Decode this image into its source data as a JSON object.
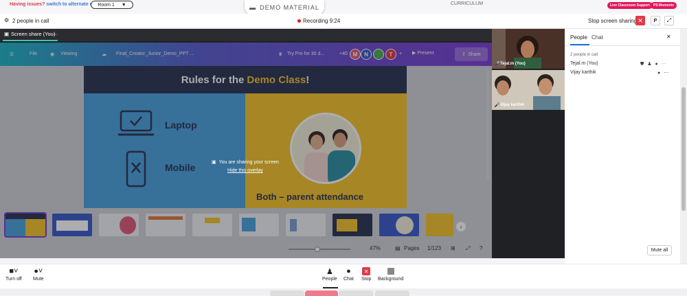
{
  "topbar": {
    "issue_text": "Having issues?",
    "switch_text": "switch to alternate room",
    "room": "Room 1",
    "demo_material": "DEMO MATERIAL",
    "curriculum": "CURRICULUM",
    "live_support": "Live Classroom Support",
    "ps_moments": "PS Moments"
  },
  "callbar": {
    "people_count": "2 people in call",
    "recording": "Recording 9:24",
    "stop_sharing": "Stop screen sharing",
    "p_label": "P"
  },
  "stage": {
    "tab_label": "Screen share (You)",
    "tab_more": "···"
  },
  "canva": {
    "file": "File",
    "viewing": "Viewing",
    "doc_name": "Final_Creator_Junior_Demo_PPT ...",
    "try_pro": "Try Pro for 30 d...",
    "plus_count": "+40",
    "avatars": [
      {
        "letter": "M",
        "color": "#e05a7a"
      },
      {
        "letter": "N",
        "color": "#3b5bc9"
      },
      {
        "letter": "",
        "color": "#4caf50"
      },
      {
        "letter": "T",
        "color": "#e03b4b"
      }
    ],
    "present": "Present",
    "share": "Share",
    "zoom": "47%",
    "pages": "Pages",
    "page_num": "1/123"
  },
  "slide": {
    "title_a": "Rules for the ",
    "title_b": "Demo Class",
    "title_c": "!",
    "laptop": "Laptop",
    "mobile": "Mobile",
    "both": "Both – parent attendance"
  },
  "overlay": {
    "message": "You are sharing your screen",
    "hide": "Hide this overlay"
  },
  "videos": [
    {
      "name": "Tejal.m (You)"
    },
    {
      "name": "Vijay karthik"
    }
  ],
  "panel": {
    "tabs": [
      "People",
      "Chat"
    ],
    "count": "2 people in call",
    "people": [
      {
        "name": "Tejal.m (You)"
      },
      {
        "name": "Vijay karthik"
      }
    ],
    "mute_all": "Mute all"
  },
  "controls": {
    "turn_off": "Turn off",
    "mute": "Mute",
    "people": "People",
    "chat": "Chat",
    "stop": "Stop",
    "background": "Background"
  },
  "colors": {
    "accent": "#1a73e8",
    "danger": "#e03b4b",
    "brand_pink": "#e0195a",
    "recording": "#d42020"
  }
}
